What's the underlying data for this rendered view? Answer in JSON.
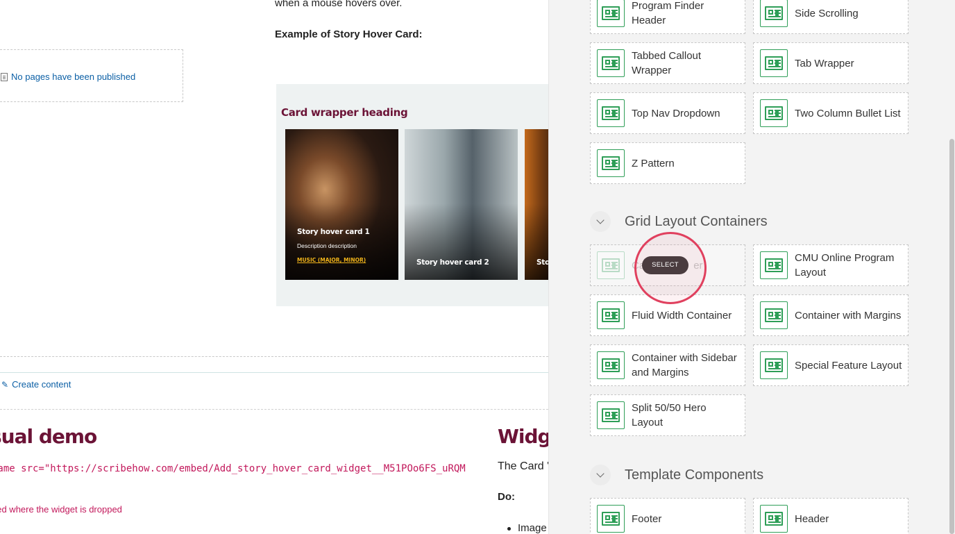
{
  "main": {
    "intro_text": "when a mouse hovers over.",
    "example_label": "Example of Story Hover Card:",
    "no_pages_link": "No pages have been published",
    "preview": {
      "heading": "Card wrapper heading",
      "cards": [
        {
          "title": "Story hover card 1",
          "description": "Description description",
          "tag": "MUSIC (MAJOR, MINOR)"
        },
        {
          "title": "Story hover card 2"
        },
        {
          "title": "Sto"
        }
      ]
    },
    "create_content_link": "Create content",
    "visual_demo_heading": "sual demo",
    "iframe_code": "rame src=\"https://scribehow.com/embed/Add_story_hover_card_widget__M51POo6FS_uRQM",
    "added_note": "ded where the widget is dropped",
    "widget_heading": "Widge",
    "card_widget_text": "The Card '",
    "do_label": "Do:",
    "bullet_item": "Image"
  },
  "panel": {
    "tiles_top": [
      {
        "label": "Program Finder Header"
      },
      {
        "label": "Side Scrolling"
      },
      {
        "label": "Tabbed Callout Wrapper"
      },
      {
        "label": "Tab Wrapper"
      },
      {
        "label": "Top Nav Dropdown"
      },
      {
        "label": "Two Column Bullet List"
      },
      {
        "label": "Z Pattern"
      }
    ],
    "grid_section": {
      "title": "Grid Layout Containers",
      "tiles": [
        {
          "label": "Card Wrapper",
          "visible_label_left": "Ca",
          "visible_label_right": "er"
        },
        {
          "label": "CMU Online Program Layout"
        },
        {
          "label": "Fluid Width Container"
        },
        {
          "label": "Container with Margins"
        },
        {
          "label": "Container with Sidebar and Margins"
        },
        {
          "label": "Special Feature Layout"
        },
        {
          "label": "Split 50/50 Hero Layout"
        }
      ]
    },
    "template_section": {
      "title": "Template Components",
      "tiles": [
        {
          "label": "Footer"
        },
        {
          "label": "Header"
        }
      ]
    },
    "select_badge": "SELECT",
    "icon": "layout-block-icon",
    "accent_color": "#2e9e57",
    "highlight_color": "#e0405e"
  }
}
